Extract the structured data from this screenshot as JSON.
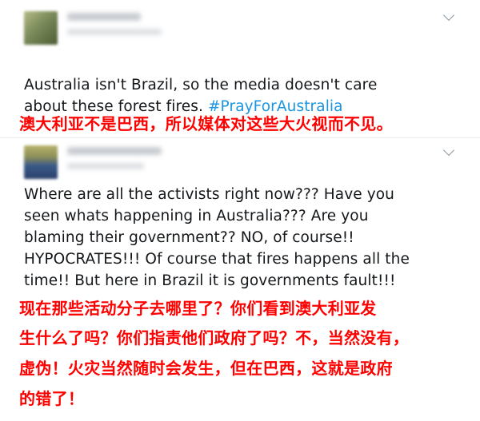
{
  "tweets": [
    {
      "text": "Australia isn't Brazil, so the media doesn't care\nabout these forest fires. ",
      "hashtag": "#PrayForAustralia",
      "avatar_colors": [
        "#7a8a5a",
        "#a4b07c",
        "#5a6a3a"
      ]
    },
    {
      "text": "Where are all the activists right now??? Have you\nseen whats happening in Australia??? Are you\nblaming their government?? NO, of course!!\nHYPOCRATES!!! Of course that fires happens all the\ntime!! But here in Brazil it is governments fault!!!",
      "avatar_colors": [
        "#a8a65a",
        "#3a5a88",
        "#2c3f6a"
      ]
    }
  ],
  "translations": {
    "first": "澳大利亚不是巴西，所以媒体对这些大火视而不见。",
    "second_lines": [
      "现在那些活动分子去哪里了？你们看到澳大利亚发",
      "生什么了吗？你们指责他们政府了吗？不，当然没有，",
      "虚伪！火灾当然随时会发生，但在巴西，这就是政府",
      "的错了！"
    ]
  },
  "colors": {
    "text": "#14171a",
    "hashtag": "#1b95e0",
    "translation": "#ff0000",
    "chevron": "#8899a6"
  }
}
